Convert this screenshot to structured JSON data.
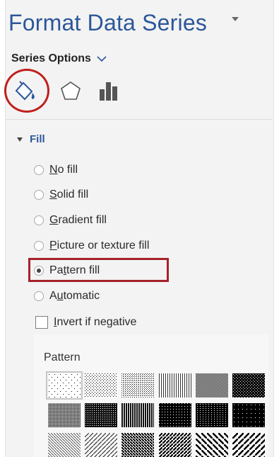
{
  "panel": {
    "title": "Format Data Series",
    "series_options_label": "Series Options"
  },
  "tabs": [
    {
      "icon": "paint-bucket-icon",
      "name": "Fill & Line",
      "selected": true
    },
    {
      "icon": "pentagon-icon",
      "name": "Effects",
      "selected": false
    },
    {
      "icon": "bar-chart-icon",
      "name": "Series Options",
      "selected": false
    }
  ],
  "fill": {
    "header": "Fill",
    "options": [
      {
        "pre": "",
        "key": "N",
        "post": "o fill",
        "checked": false
      },
      {
        "pre": "",
        "key": "S",
        "post": "olid fill",
        "checked": false
      },
      {
        "pre": "",
        "key": "G",
        "post": "radient fill",
        "checked": false
      },
      {
        "pre": "",
        "key": "P",
        "post": "icture or texture fill",
        "checked": false
      },
      {
        "pre": "Pa",
        "key": "t",
        "post": "tern fill",
        "checked": true
      },
      {
        "pre": "A",
        "key": "u",
        "post": "tomatic",
        "checked": false
      }
    ],
    "invert": {
      "pre": "",
      "key": "I",
      "post": "nvert if negative",
      "checked": false
    },
    "pattern_label": "Pattern",
    "selected_pattern_index": 0
  },
  "colors": {
    "accent": "#2b579a",
    "highlight_red": "#c0201d",
    "panel_bg": "#f3f3f3"
  }
}
